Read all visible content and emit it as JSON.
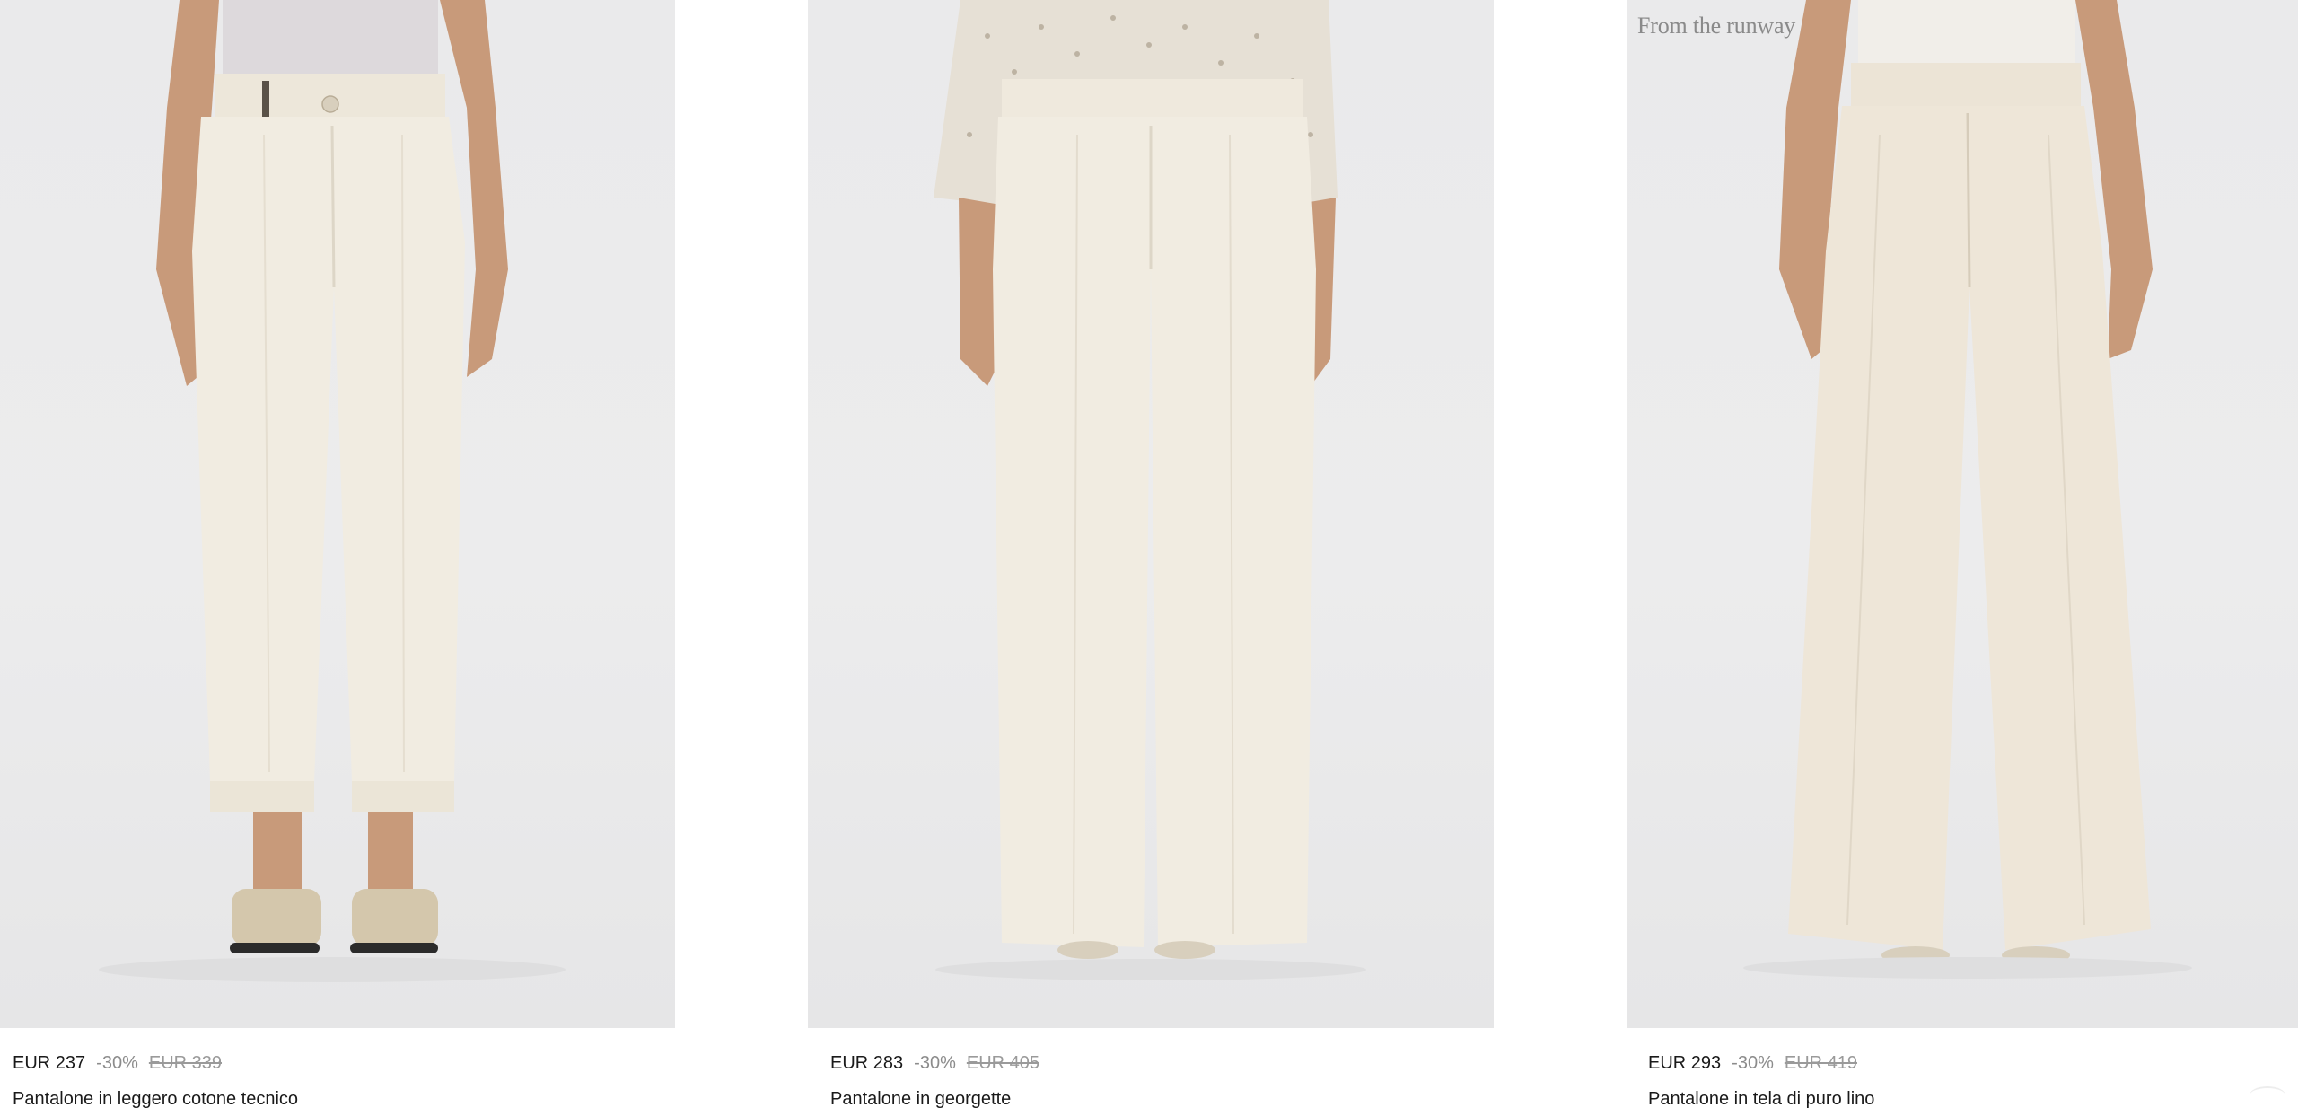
{
  "products": [
    {
      "price": "EUR 237",
      "discount": "-30%",
      "original_price": "EUR 339",
      "name": "Pantalone in leggero cotone tecnico"
    },
    {
      "price": "EUR 283",
      "discount": "-30%",
      "original_price": "EUR 405",
      "name": "Pantalone in georgette"
    },
    {
      "badge": "From the runway",
      "price": "EUR 293",
      "discount": "-30%",
      "original_price": "EUR 419",
      "name": "Pantalone in tela di puro lino"
    }
  ],
  "colors": {
    "image_background": "#ebebec",
    "trouser_fabric": "#f1ece1",
    "text": "#1a1a1a",
    "muted_text": "#8c8c8c"
  }
}
